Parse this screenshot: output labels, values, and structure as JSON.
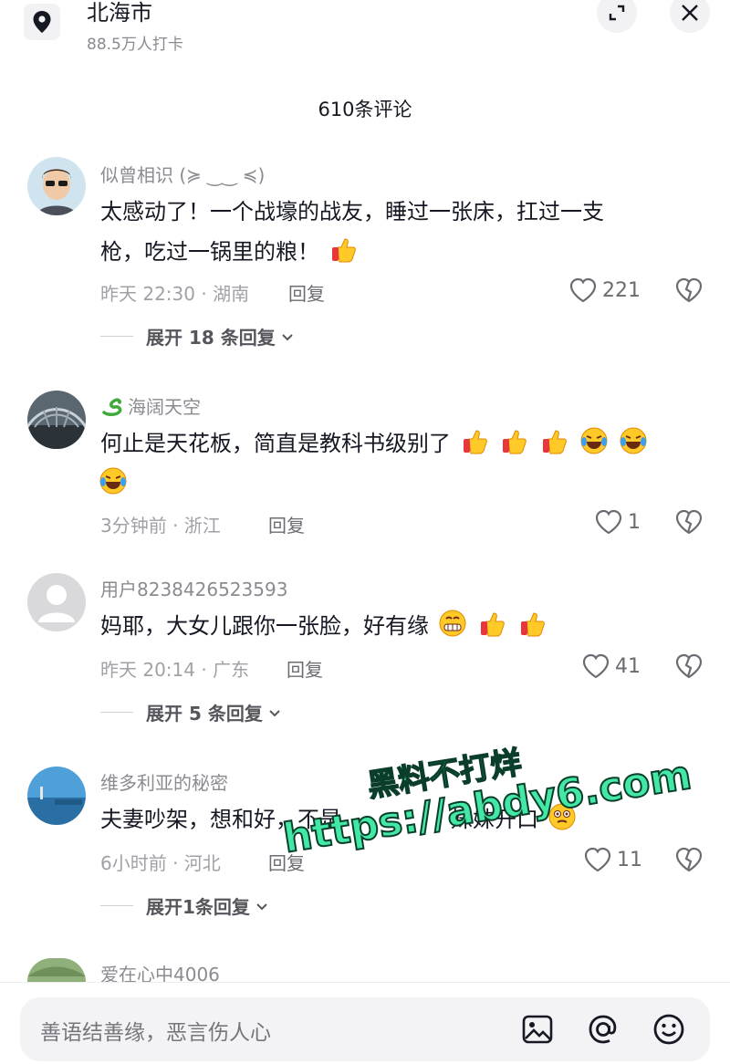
{
  "location": {
    "title": "北海市",
    "checkins": "88.5万人打卡"
  },
  "comment_count": "610条评论",
  "reply_label": "回复",
  "comments": [
    {
      "username": "似曾相识 (≽ ‿‿ ≼)",
      "text_line1": "太感动了！一个战壕的战友，睡过一张床，扛过一支",
      "text_line2": "枪，吃过一锅里的粮！",
      "meta": "昨天 22:30 · 湖南",
      "likes": "221",
      "expand": "展开 18 条回复"
    },
    {
      "username_icon": "snake-emoji",
      "username": "海阔天空",
      "text_line1": "何止是天花板，简直是教科书级别了",
      "meta": "3分钟前 · 浙江",
      "likes": "1"
    },
    {
      "username": "用户8238426523593",
      "text_line1": "妈耶，大女儿跟你一张脸，好有缘",
      "meta": "昨天 20:14 · 广东",
      "likes": "41",
      "expand": "展开 5 条回复"
    },
    {
      "username": "维多利亚的秘密",
      "text_line1": "夫妻吵架，想和好，不是",
      "text_line1_end": "妹妹开口",
      "meta": "6小时前 · 河北",
      "likes": "11",
      "expand": "展开1条回复"
    },
    {
      "username": "爱在心中4006"
    }
  ],
  "watermark": {
    "line1": "黑料不打烊",
    "line2": "https://abdy6.com"
  },
  "input": {
    "placeholder": "善语结善缘，恶言伤人心"
  },
  "colors": {
    "text": "#161823",
    "secondary": "#8a8b91",
    "watermark": "#43e8a6"
  }
}
